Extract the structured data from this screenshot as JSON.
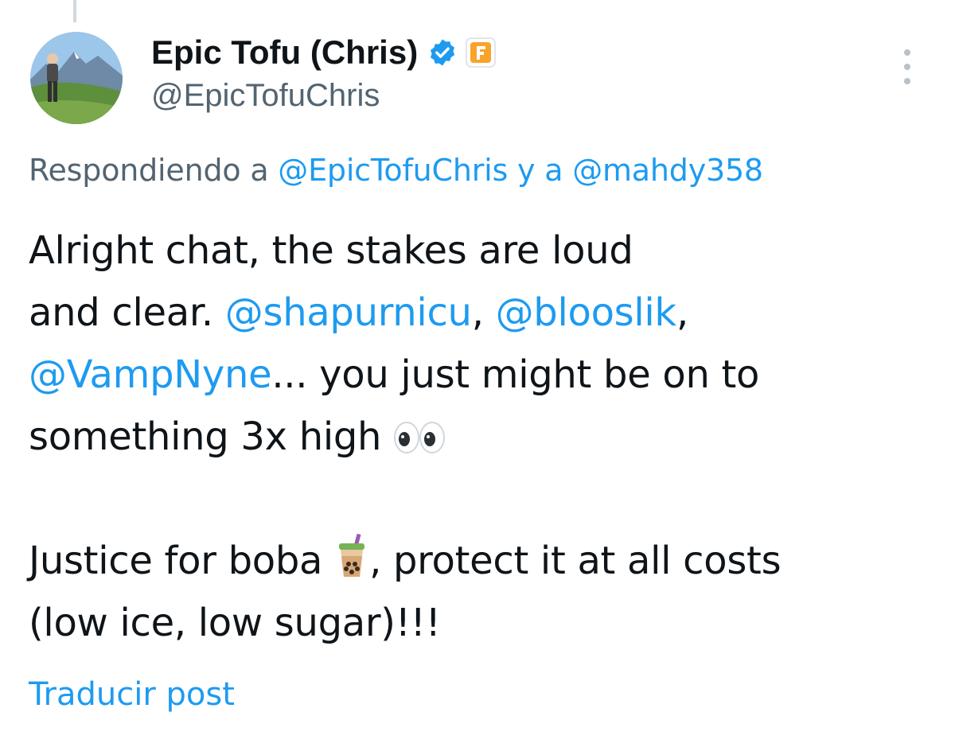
{
  "author": {
    "display_name": "Epic Tofu (Chris)",
    "handle": "@EpicTofuChris",
    "verified": true,
    "affiliate_badge_letter": "F",
    "affiliate_badge_color": "#f7a429",
    "verified_color": "#1d9bf0"
  },
  "reply_context": {
    "prefix": "Respondiendo a",
    "user1": "@EpicTofuChris",
    "joiner": "y a",
    "user2": "@mahdy358"
  },
  "tweet": {
    "line1": "Alright chat, the stakes are loud",
    "line2_text": "and clear. ",
    "mention1": "@shapurnicu",
    "sep1": ", ",
    "mention2": "@blooslik",
    "sep2": ",",
    "mention3": "@VampNyne",
    "line3_text": "... you just might be on to",
    "line4_text": "something 3x high",
    "emoji_eyes": "eyes-emoji",
    "line5_text_a": "Justice for boba",
    "emoji_boba": "bubble-tea-emoji",
    "line5_text_b": ", protect it at all costs",
    "line6_text": "(low ice, low sugar)!!!"
  },
  "translate_label": "Traducir post",
  "colors": {
    "link": "#1d9bf0",
    "secondary_text": "#536471",
    "primary_text": "#0f1419"
  }
}
